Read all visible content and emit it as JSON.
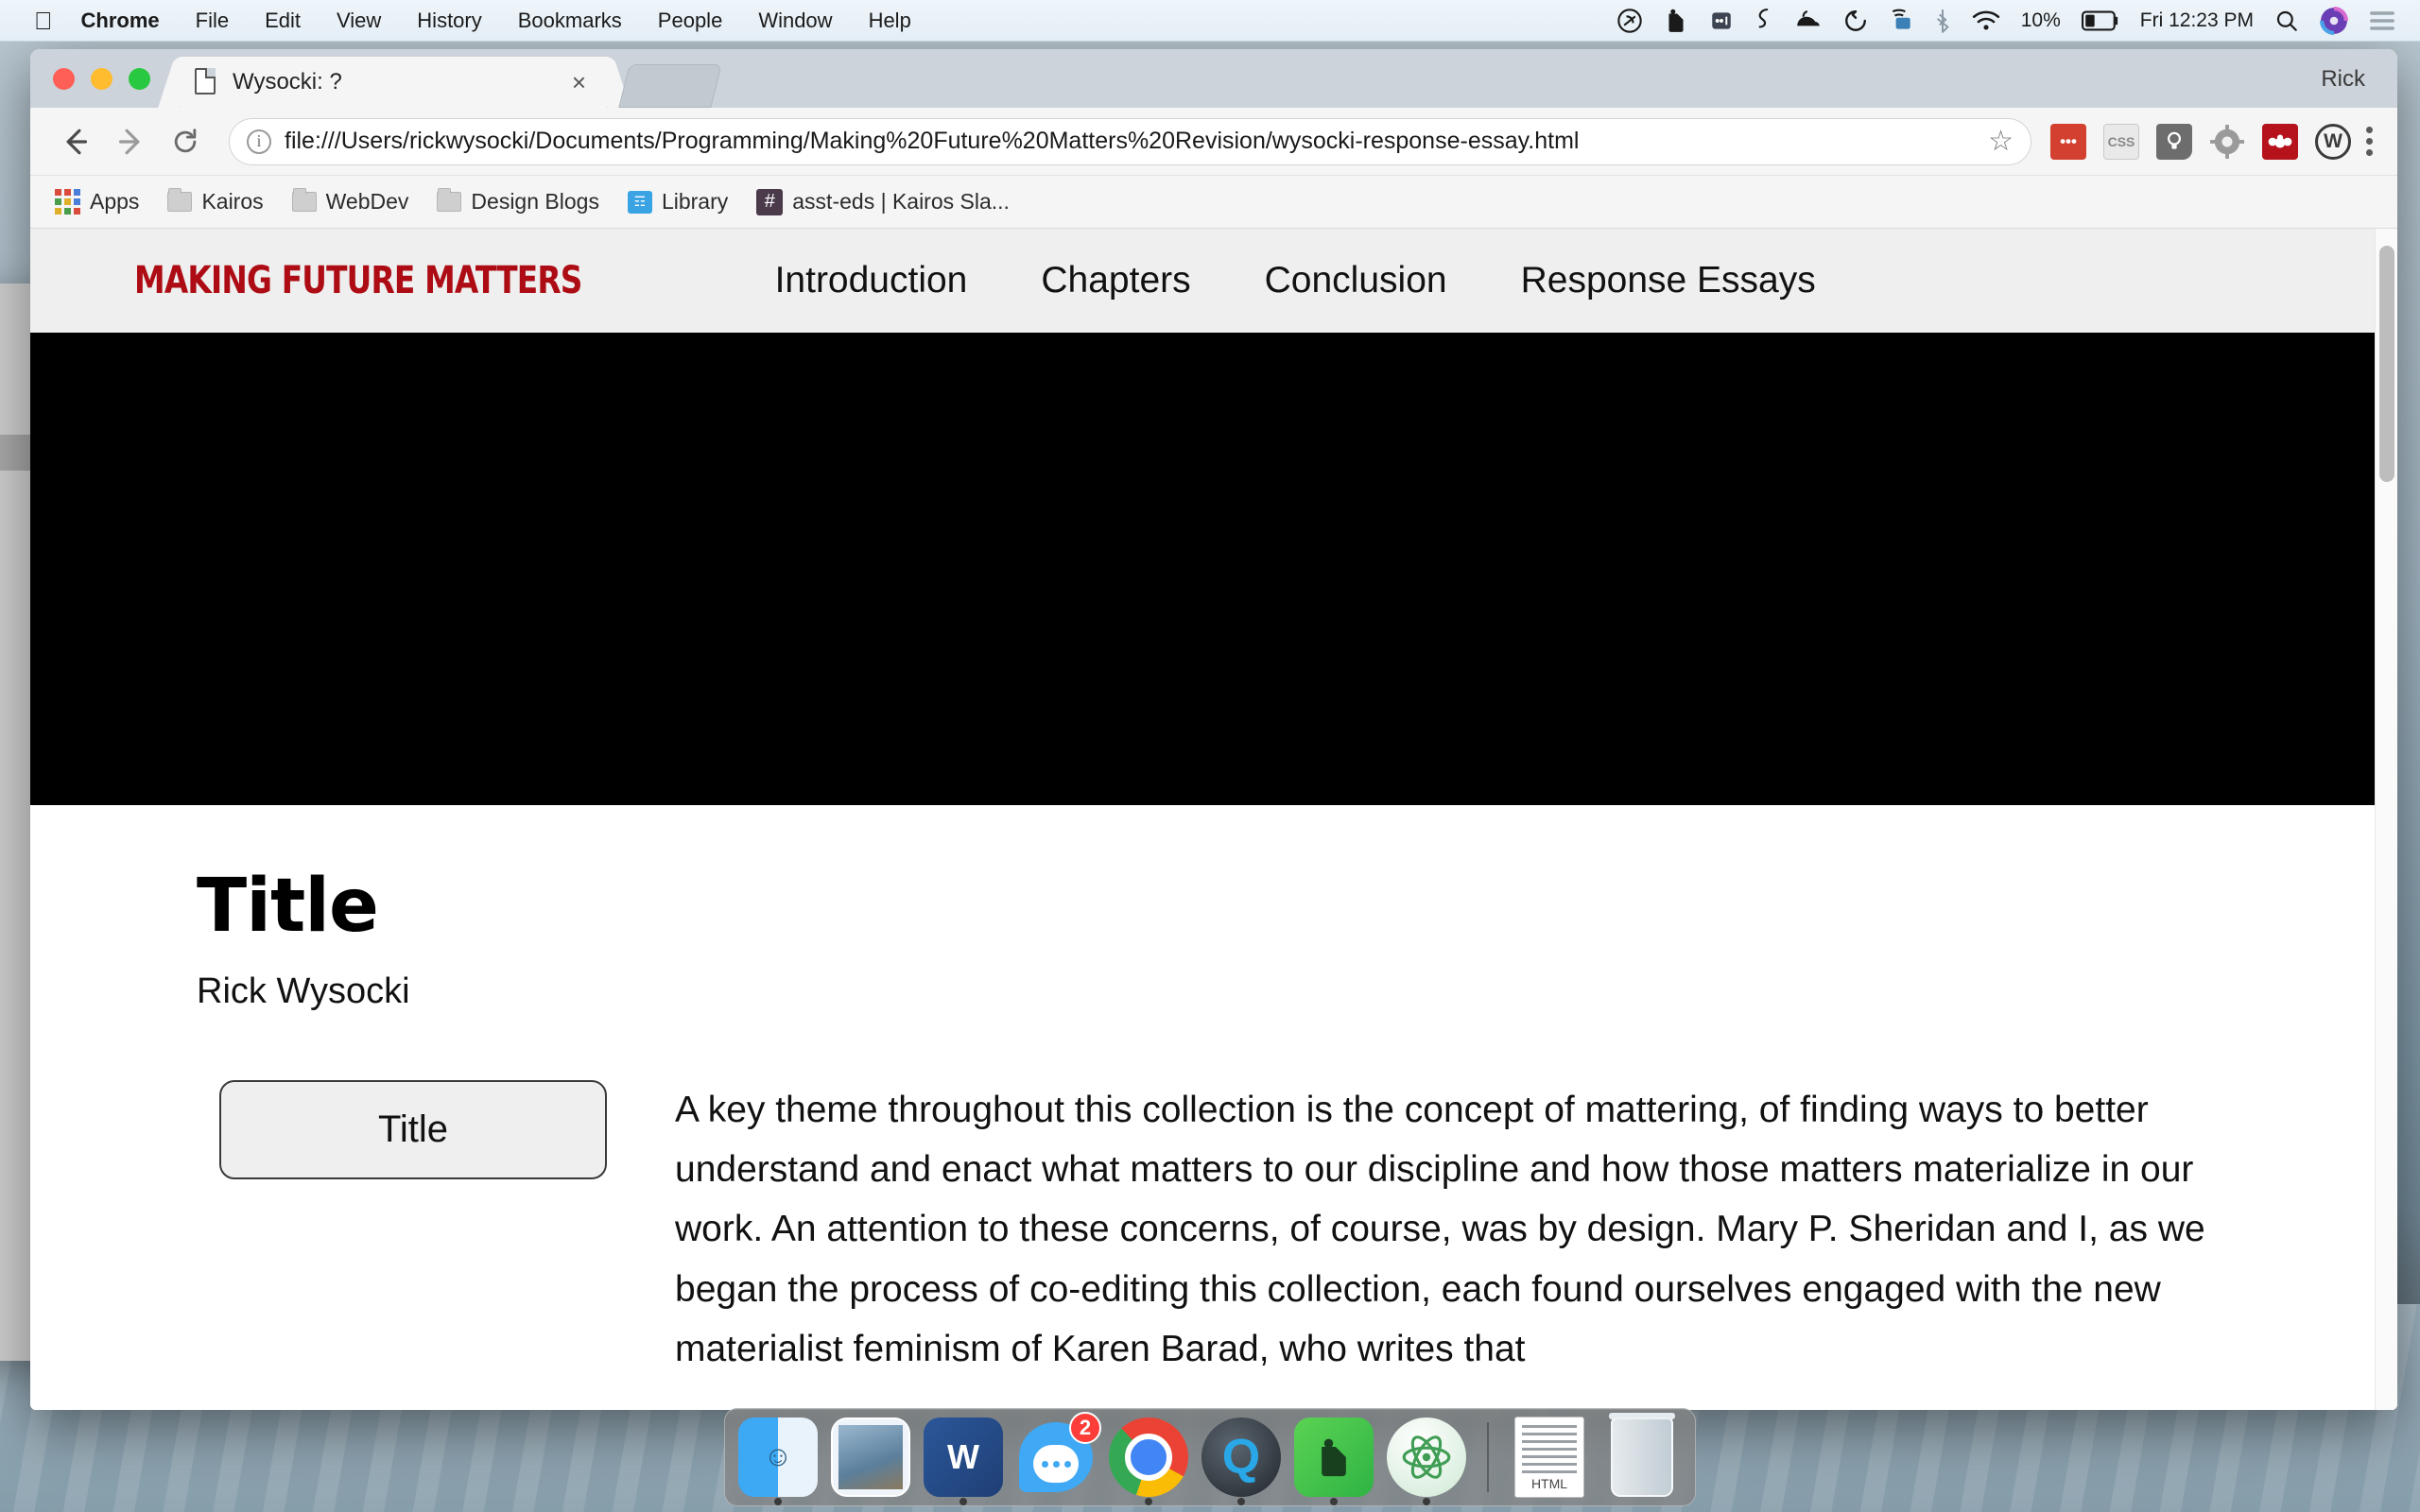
{
  "menubar": {
    "apple_icon": "apple-logo",
    "items": [
      {
        "label": "Chrome",
        "bold": true
      },
      {
        "label": "File",
        "bold": false
      },
      {
        "label": "Edit",
        "bold": false
      },
      {
        "label": "View",
        "bold": false
      },
      {
        "label": "History",
        "bold": false
      },
      {
        "label": "Bookmarks",
        "bold": false
      },
      {
        "label": "People",
        "bold": false
      },
      {
        "label": "Window",
        "bold": false
      },
      {
        "label": "Help",
        "bold": false
      }
    ],
    "status_icons": [
      "creative-cloud-icon",
      "evernote-icon",
      "lastpass-icon",
      "sizeup-icon",
      "hazel-icon",
      "timing-icon",
      "airserver-icon",
      "bluetooth-icon",
      "wifi-icon"
    ],
    "battery_percent": "10%",
    "clock": "Fri 12:23 PM",
    "search_icon": "spotlight-search-icon",
    "siri_icon": "siri-icon",
    "notification_icon": "notification-center-icon"
  },
  "window": {
    "user_label": "Rick",
    "traffic_lights": [
      "close-button",
      "minimize-button",
      "maximize-button"
    ]
  },
  "tab": {
    "favicon": "document-icon",
    "title": "Wysocki: ?",
    "close_icon": "×"
  },
  "toolbar": {
    "back_icon": "back-arrow-icon",
    "forward_icon": "forward-arrow-icon",
    "reload_icon": "reload-icon",
    "info_icon": "i",
    "url": "file:///Users/rickwysocki/Documents/Programming/Making%20Future%20Matters%20Revision/wysocki-response-essay.html",
    "star_icon": "☆",
    "extensions": [
      {
        "name": "lastpass-extension-icon",
        "glyph": "•••"
      },
      {
        "name": "css-viewer-extension-icon",
        "glyph": "CSS"
      },
      {
        "name": "lightbulb-note-extension-icon",
        "glyph": "○"
      },
      {
        "name": "gear-extension-icon",
        "glyph": "⚙"
      },
      {
        "name": "mendeley-extension-icon",
        "glyph": "M"
      },
      {
        "name": "wikipedia-extension-icon",
        "glyph": "W"
      }
    ],
    "menu_icon": "kebab-menu-icon"
  },
  "bookmarks": [
    {
      "label": "Apps",
      "icon": "apps-grid-icon"
    },
    {
      "label": "Kairos",
      "icon": "folder-icon"
    },
    {
      "label": "WebDev",
      "icon": "folder-icon"
    },
    {
      "label": "Design Blogs",
      "icon": "folder-icon"
    },
    {
      "label": "Library",
      "icon": "library-icon"
    },
    {
      "label": "asst-eds | Kairos Sla...",
      "icon": "slack-icon"
    }
  ],
  "site": {
    "logo": "MAKING FUTURE MATTERS",
    "logo_color": "#AD0C15",
    "nav": [
      {
        "label": "Introduction"
      },
      {
        "label": "Chapters"
      },
      {
        "label": "Conclusion"
      },
      {
        "label": "Response Essays"
      }
    ],
    "hero_color": "#000000"
  },
  "article": {
    "title": "Title",
    "author": "Rick Wysocki",
    "side_button": "Title",
    "body": "A key theme throughout this collection is the concept of mattering, of finding ways to better understand and enact what matters to our discipline and how those matters materialize in our work. An attention to these concerns, of course, was by design. Mary P. Sheridan and I, as we began the process of co-editing this collection, each found ourselves engaged with the new materialist feminism of Karen Barad, who writes that"
  },
  "dock": {
    "items": [
      {
        "name": "finder-dock-icon",
        "running": true
      },
      {
        "name": "mail-dock-icon",
        "running": false
      },
      {
        "name": "word-dock-icon",
        "running": true
      },
      {
        "name": "messages-dock-icon",
        "running": false,
        "badge": "2"
      },
      {
        "name": "chrome-dock-icon",
        "running": true
      },
      {
        "name": "quicktime-dock-icon",
        "running": true
      },
      {
        "name": "evernote-dock-icon",
        "running": true
      },
      {
        "name": "atom-dock-icon",
        "running": true
      }
    ],
    "file_label": "HTML",
    "trash": "trash-dock-icon"
  }
}
